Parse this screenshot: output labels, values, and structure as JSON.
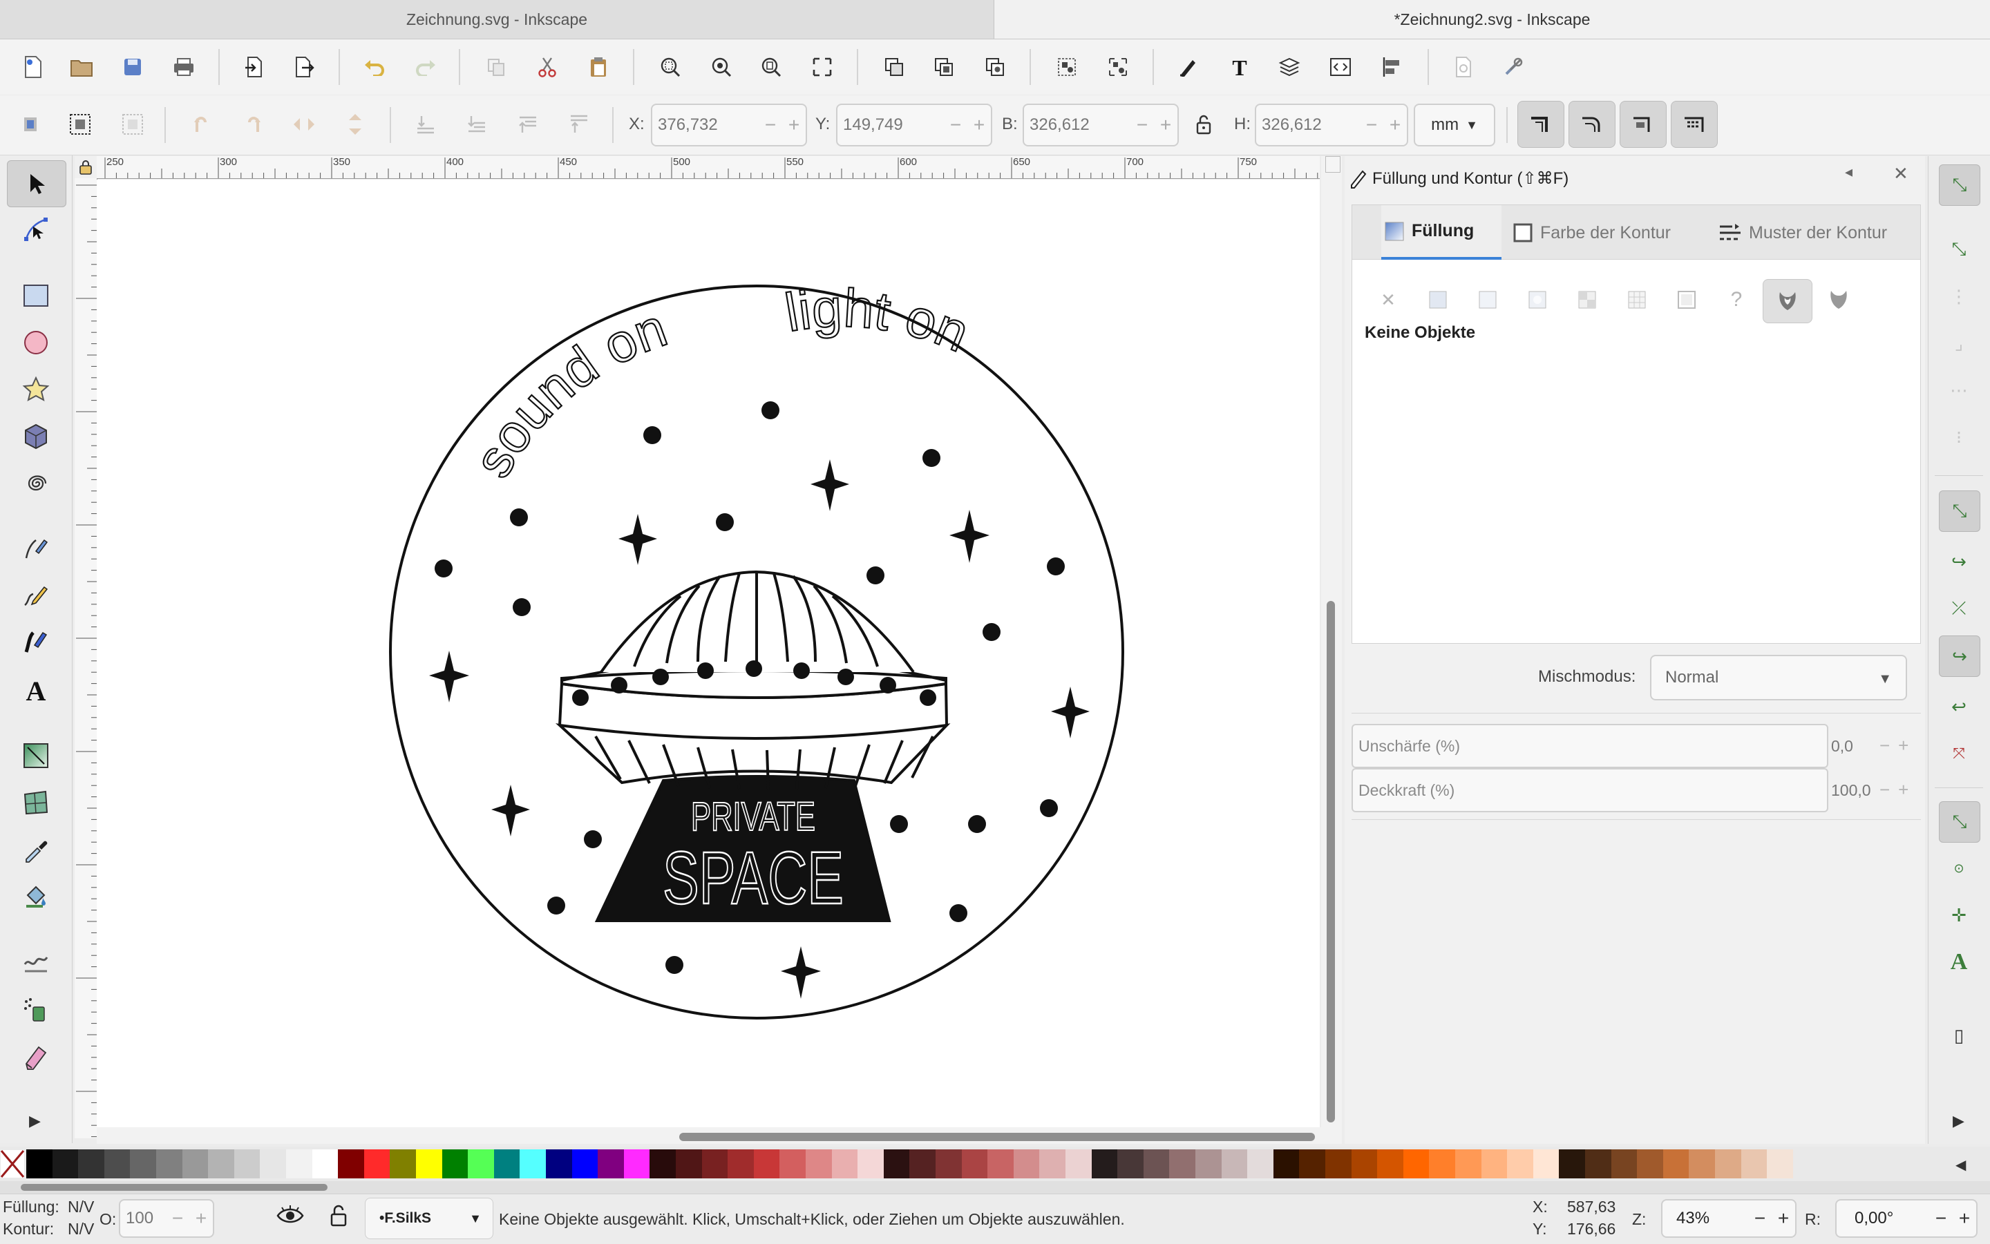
{
  "window_tabs": [
    {
      "title": "Zeichnung.svg - Inkscape"
    },
    {
      "title": "*Zeichnung2.svg - Inkscape"
    }
  ],
  "icons": {
    "new": "new-document-icon",
    "open": "open-icon",
    "save": "save-icon",
    "print": "print-icon",
    "import": "import-icon",
    "export": "export-icon",
    "undo": "undo-icon",
    "redo": "redo-icon",
    "copy": "copy-icon",
    "cut": "cut-icon",
    "paste": "paste-icon",
    "zoom_sel": "zoom-selection-icon",
    "zoom_draw": "zoom-drawing-icon",
    "zoom_page": "zoom-page-icon",
    "zoom_width": "zoom-width-icon",
    "duplicate": "duplicate-icon",
    "clone": "clone-icon",
    "unlink": "unlink-clone-icon",
    "group": "group-icon",
    "ungroup": "ungroup-icon",
    "fill_stroke": "fill-stroke-icon",
    "text": "text-icon",
    "layers": "layers-icon",
    "xml": "xml-editor-icon",
    "align": "align-icon",
    "doc_props": "document-properties-icon",
    "prefs": "preferences-icon"
  },
  "controls": {
    "x_label": "X:",
    "x_value": "376,732",
    "y_label": "Y:",
    "y_value": "149,749",
    "w_label": "B:",
    "w_value": "326,612",
    "h_label": "H:",
    "h_value": "326,612",
    "unit": "mm"
  },
  "ruler": {
    "h_ticks": [
      "250",
      "300",
      "350",
      "400",
      "450",
      "500",
      "550",
      "600",
      "650",
      "700",
      "750"
    ]
  },
  "artwork": {
    "arc_left": "sound on",
    "arc_right": "light on",
    "badge_top": "PRIVATE",
    "badge_bottom": "SPACE"
  },
  "dock": {
    "title": "Füllung und Kontur (⇧⌘F)",
    "tabs": [
      {
        "label": "Füllung"
      },
      {
        "label": "Farbe der Kontur"
      },
      {
        "label": "Muster der Kontur"
      }
    ],
    "no_objects": "Keine Objekte",
    "blend_label": "Mischmodus:",
    "blend_value": "Normal",
    "blur_label": "Unschärfe (%)",
    "blur_value": "0,0",
    "opacity_label": "Deckkraft (%)",
    "opacity_value": "100,0"
  },
  "palette": {
    "colors": [
      "#000000",
      "#1a1a1a",
      "#333333",
      "#4d4d4d",
      "#666666",
      "#808080",
      "#999999",
      "#b3b3b3",
      "#cccccc",
      "#e6e6e6",
      "#f2f2f2",
      "#ffffff",
      "#800000",
      "#ff2a2a",
      "#808000",
      "#ffff00",
      "#008000",
      "#55ff55",
      "#008080",
      "#55ffff",
      "#000080",
      "#0000ff",
      "#800080",
      "#ff2aff",
      "#280b0b",
      "#501616",
      "#782121",
      "#a02c2c",
      "#c83737",
      "#d35f5f",
      "#de8787",
      "#e9afaf",
      "#f4d7d7",
      "#2b1111",
      "#552222",
      "#803333",
      "#aa4444",
      "#c86464",
      "#d38d8d",
      "#deb0b0",
      "#ebd2d2",
      "#241c1c",
      "#483737",
      "#6c5353",
      "#916f6f",
      "#ac9393",
      "#c8b7b7",
      "#e3dbdb",
      "#2b1100",
      "#552200",
      "#803300",
      "#aa4400",
      "#d45500",
      "#ff6600",
      "#ff7f2a",
      "#ff9955",
      "#ffb380",
      "#ffccaa",
      "#ffe6d5",
      "#28170b",
      "#502d16",
      "#784421",
      "#a05a2c",
      "#c87137",
      "#d38d5f",
      "#deaa87",
      "#e9c6af",
      "#f4e3d7"
    ]
  },
  "status": {
    "fill_label": "Füllung:",
    "fill_value": "N/V",
    "stroke_label": "Kontur:",
    "stroke_value": "N/V",
    "opacity_label": "O:",
    "opacity_value": "100",
    "layer": "•F.SilkS",
    "message": "Keine Objekte ausgewählt. Klick, Umschalt+Klick, oder Ziehen um Objekte auszuwählen.",
    "cursor_x_label": "X:",
    "cursor_x": "587,63",
    "cursor_y_label": "Y:",
    "cursor_y": "176,66",
    "zoom_label": "Z:",
    "zoom": "43%",
    "rotate_label": "R:",
    "rotate": "0,00°"
  }
}
